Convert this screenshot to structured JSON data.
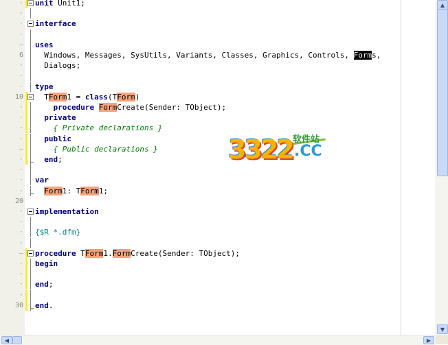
{
  "editor": {
    "lines": [
      {
        "num": "",
        "tokens": [
          {
            "t": "kw",
            "v": "unit"
          },
          {
            "t": "",
            "v": " Unit1;"
          }
        ]
      },
      {
        "num": "",
        "tokens": []
      },
      {
        "num": "",
        "tokens": [
          {
            "t": "kw",
            "v": "interface"
          }
        ]
      },
      {
        "num": "",
        "tokens": []
      },
      {
        "num": "",
        "tokens": [
          {
            "t": "kw",
            "v": "uses"
          }
        ]
      },
      {
        "num": "6",
        "tokens": [
          {
            "t": "",
            "v": "  Windows, Messages, SysUtils, Variants, Classes, Graphics, Controls, "
          },
          {
            "t": "sel",
            "v": "Form"
          },
          {
            "t": "",
            "v": "s,"
          }
        ]
      },
      {
        "num": "",
        "tokens": [
          {
            "t": "",
            "v": "  Dialogs;"
          }
        ]
      },
      {
        "num": "",
        "tokens": []
      },
      {
        "num": "",
        "tokens": [
          {
            "t": "kw",
            "v": "type"
          }
        ]
      },
      {
        "num": "10",
        "tokens": [
          {
            "t": "",
            "v": "  T"
          },
          {
            "t": "hl",
            "v": "Form"
          },
          {
            "t": "",
            "v": "1 = "
          },
          {
            "t": "kw",
            "v": "class"
          },
          {
            "t": "",
            "v": "(T"
          },
          {
            "t": "hl",
            "v": "Form"
          },
          {
            "t": "",
            "v": ")"
          }
        ]
      },
      {
        "num": "",
        "tokens": [
          {
            "t": "",
            "v": "    "
          },
          {
            "t": "kw",
            "v": "procedure"
          },
          {
            "t": "",
            "v": " "
          },
          {
            "t": "hl",
            "v": "Form"
          },
          {
            "t": "",
            "v": "Create(Sender: TObject);"
          }
        ]
      },
      {
        "num": "",
        "tokens": [
          {
            "t": "",
            "v": "  "
          },
          {
            "t": "kw",
            "v": "private"
          }
        ]
      },
      {
        "num": "",
        "tokens": [
          {
            "t": "cm",
            "v": "    { Private declarations }"
          }
        ]
      },
      {
        "num": "",
        "tokens": [
          {
            "t": "",
            "v": "  "
          },
          {
            "t": "kw",
            "v": "public"
          }
        ]
      },
      {
        "num": "",
        "tokens": [
          {
            "t": "cm",
            "v": "    { Public declarations }"
          }
        ]
      },
      {
        "num": "",
        "tokens": [
          {
            "t": "",
            "v": "  "
          },
          {
            "t": "kw",
            "v": "end"
          },
          {
            "t": "",
            "v": ";"
          }
        ]
      },
      {
        "num": "",
        "tokens": []
      },
      {
        "num": "",
        "tokens": [
          {
            "t": "kw",
            "v": "var"
          }
        ]
      },
      {
        "num": "",
        "tokens": [
          {
            "t": "",
            "v": "  "
          },
          {
            "t": "hl",
            "v": "Form"
          },
          {
            "t": "",
            "v": "1: T"
          },
          {
            "t": "hl",
            "v": "Form"
          },
          {
            "t": "",
            "v": "1;"
          }
        ]
      },
      {
        "num": "20",
        "tokens": []
      },
      {
        "num": "",
        "tokens": [
          {
            "t": "kw",
            "v": "implementation"
          }
        ]
      },
      {
        "num": "",
        "tokens": []
      },
      {
        "num": "",
        "tokens": [
          {
            "t": "dir",
            "v": "{$R *.dfm}"
          }
        ]
      },
      {
        "num": "",
        "tokens": []
      },
      {
        "num": "",
        "tokens": [
          {
            "t": "kw",
            "v": "procedure"
          },
          {
            "t": "",
            "v": " T"
          },
          {
            "t": "hl",
            "v": "Form"
          },
          {
            "t": "",
            "v": "1."
          },
          {
            "t": "hl",
            "v": "Form"
          },
          {
            "t": "",
            "v": "Create(Sender: TObject);"
          }
        ]
      },
      {
        "num": "",
        "tokens": [
          {
            "t": "kw",
            "v": "begin"
          }
        ]
      },
      {
        "num": "",
        "tokens": []
      },
      {
        "num": "",
        "tokens": [
          {
            "t": "kw",
            "v": "end"
          },
          {
            "t": "",
            "v": ";"
          }
        ]
      },
      {
        "num": "",
        "tokens": []
      },
      {
        "num": "30",
        "tokens": [
          {
            "t": "kw",
            "v": "end"
          },
          {
            "t": "",
            "v": "."
          }
        ]
      }
    ]
  },
  "watermark": {
    "digits": "3322",
    "suffix": ".CC",
    "chinese": "软件站"
  },
  "scrollbar": {
    "up_glyph": "▲",
    "down_glyph": "▼",
    "left_glyph": "◀",
    "right_glyph": "▶"
  }
}
